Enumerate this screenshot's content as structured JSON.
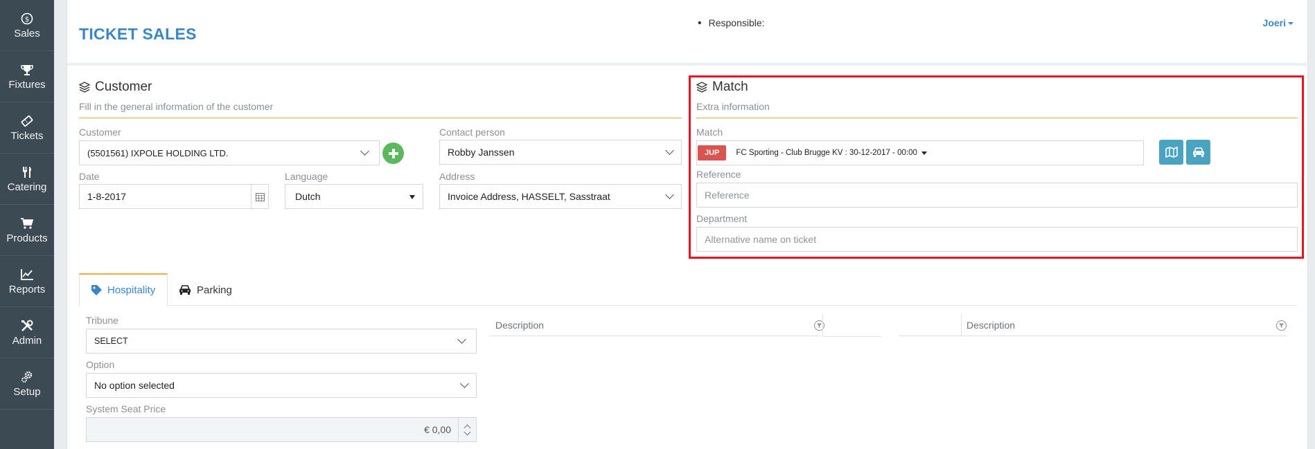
{
  "sidebar": {
    "items": [
      {
        "label": "Sales",
        "icon": "dollar-circle-icon"
      },
      {
        "label": "Fixtures",
        "icon": "trophy-icon"
      },
      {
        "label": "Tickets",
        "icon": "ticket-icon"
      },
      {
        "label": "Catering",
        "icon": "cutlery-icon"
      },
      {
        "label": "Products",
        "icon": "cart-icon"
      },
      {
        "label": "Reports",
        "icon": "line-chart-icon"
      },
      {
        "label": "Admin",
        "icon": "tools-icon"
      },
      {
        "label": "Setup",
        "icon": "gears-icon"
      }
    ]
  },
  "header": {
    "title": "TICKET SALES",
    "responsible_label": "Responsible:",
    "user": "Joeri"
  },
  "customer_section": {
    "title": "Customer",
    "subtitle": "Fill in the general information of the customer",
    "customer_label": "Customer",
    "customer_value": "(5501561) IXPOLE HOLDING LTD.",
    "contact_label": "Contact person",
    "contact_value": "Robby Janssen",
    "date_label": "Date",
    "date_value": "1-8-2017",
    "language_label": "Language",
    "language_value": "Dutch",
    "address_label": "Address",
    "address_value": "Invoice Address, HASSELT, Sasstraat"
  },
  "match_section": {
    "title": "Match",
    "subtitle": "Extra information",
    "match_label": "Match",
    "match_badge": "JUP",
    "match_value": "FC Sporting - Club Brugge KV : 30-12-2017 - 00:00",
    "reference_label": "Reference",
    "reference_placeholder": "Reference",
    "department_label": "Department",
    "department_placeholder": "Alternative name on ticket"
  },
  "tabs": [
    {
      "label": "Hospitality",
      "icon": "tag-icon",
      "active": true
    },
    {
      "label": "Parking",
      "icon": "car-icon",
      "active": false
    }
  ],
  "hospitality": {
    "tribune_label": "Tribune",
    "tribune_value": "SELECT",
    "option_label": "Option",
    "option_value": "No option selected",
    "price_label": "System Seat Price",
    "price_value": "€ 0,00",
    "table1_header": "Description",
    "table2_header": "Description"
  },
  "colors": {
    "accent": "#3a87c7",
    "sidebar": "#3c4a54",
    "highlight": "#e5161d",
    "section_line": "#f0a93a",
    "badge": "#d9534f",
    "icon_button": "#4aa3c1",
    "add_button": "#5cb85c"
  }
}
